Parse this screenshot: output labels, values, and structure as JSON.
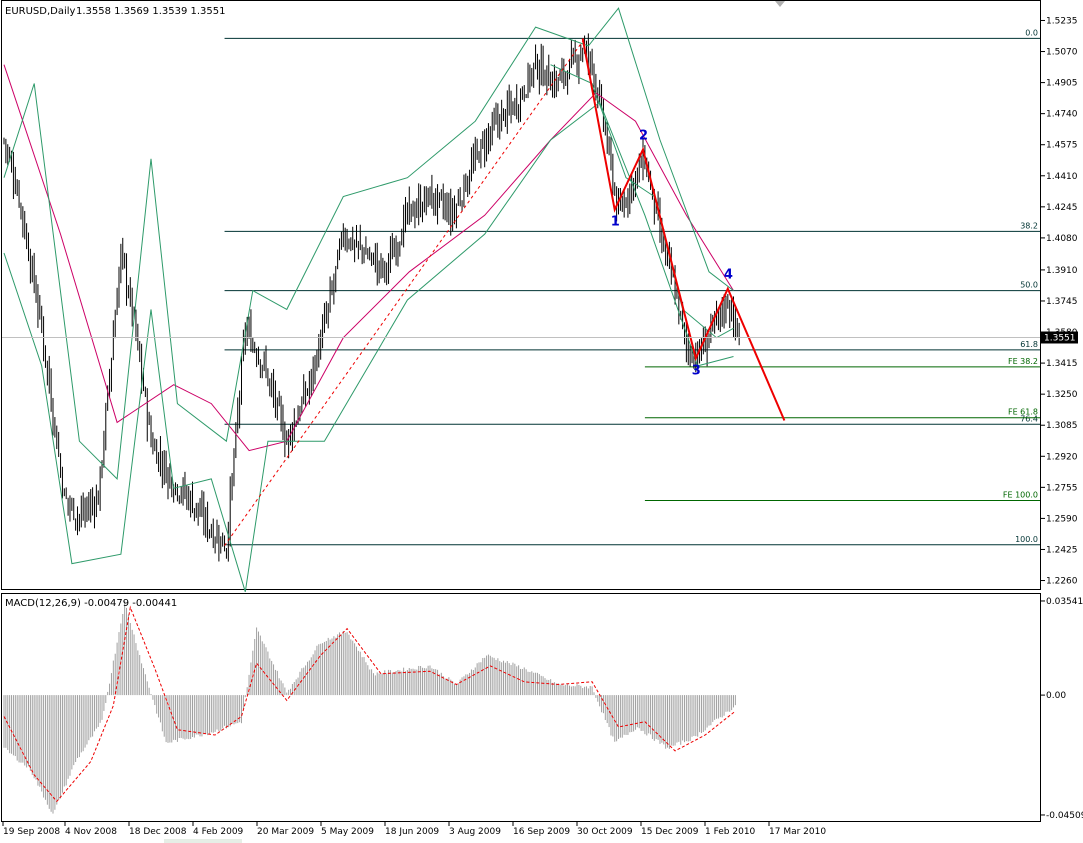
{
  "chart_data": [
    {
      "type": "candlestick",
      "title": "EURUSD,Daily",
      "ohlc_readout": "1.3558 1.3569 1.3539 1.3551",
      "current_price_label": "1.3551",
      "y_ticks": [
        "1.5235",
        "1.5070",
        "1.4905",
        "1.4740",
        "1.4575",
        "1.4410",
        "1.4245",
        "1.4080",
        "1.3910",
        "1.3745",
        "1.3580",
        "1.3415",
        "1.3250",
        "1.3085",
        "1.2920",
        "1.2755",
        "1.2590",
        "1.2425",
        "1.2260"
      ],
      "ylim": [
        1.2215,
        1.528
      ],
      "x_ticks": [
        "19 Sep 2008",
        "4 Nov 2008",
        "18 Dec 2008",
        "4 Feb 2009",
        "20 Mar 2009",
        "5 May 2009",
        "18 Jun 2009",
        "3 Aug 2009",
        "16 Sep 2009",
        "30 Oct 2009",
        "15 Dec 2009",
        "1 Feb 2010",
        "17 Mar 2010"
      ],
      "price_path": [
        {
          "bar": 0,
          "price": 1.46
        },
        {
          "bar": 8,
          "price": 1.43
        },
        {
          "bar": 20,
          "price": 1.36
        },
        {
          "bar": 32,
          "price": 1.27
        },
        {
          "bar": 40,
          "price": 1.26
        },
        {
          "bar": 50,
          "price": 1.27
        },
        {
          "bar": 62,
          "price": 1.4
        },
        {
          "bar": 68,
          "price": 1.37
        },
        {
          "bar": 78,
          "price": 1.3
        },
        {
          "bar": 88,
          "price": 1.28
        },
        {
          "bar": 98,
          "price": 1.27
        },
        {
          "bar": 112,
          "price": 1.25
        },
        {
          "bar": 118,
          "price": 1.245
        },
        {
          "bar": 128,
          "price": 1.36
        },
        {
          "bar": 138,
          "price": 1.34
        },
        {
          "bar": 150,
          "price": 1.3
        },
        {
          "bar": 162,
          "price": 1.33
        },
        {
          "bar": 172,
          "price": 1.37
        },
        {
          "bar": 180,
          "price": 1.41
        },
        {
          "bar": 192,
          "price": 1.4
        },
        {
          "bar": 202,
          "price": 1.39
        },
        {
          "bar": 214,
          "price": 1.42
        },
        {
          "bar": 226,
          "price": 1.43
        },
        {
          "bar": 238,
          "price": 1.42
        },
        {
          "bar": 250,
          "price": 1.45
        },
        {
          "bar": 262,
          "price": 1.47
        },
        {
          "bar": 272,
          "price": 1.48
        },
        {
          "bar": 282,
          "price": 1.5
        },
        {
          "bar": 292,
          "price": 1.49
        },
        {
          "bar": 302,
          "price": 1.5
        },
        {
          "bar": 307,
          "price": 1.51
        },
        {
          "bar": 312,
          "price": 1.5
        },
        {
          "bar": 318,
          "price": 1.47
        },
        {
          "bar": 326,
          "price": 1.42
        },
        {
          "bar": 332,
          "price": 1.435
        },
        {
          "bar": 340,
          "price": 1.45
        },
        {
          "bar": 348,
          "price": 1.41
        },
        {
          "bar": 356,
          "price": 1.38
        },
        {
          "bar": 362,
          "price": 1.35
        },
        {
          "bar": 368,
          "price": 1.345
        },
        {
          "bar": 376,
          "price": 1.36
        },
        {
          "bar": 384,
          "price": 1.375
        },
        {
          "bar": 390,
          "price": 1.355
        }
      ],
      "overlays": [
        {
          "name": "MA",
          "color": "#cc0066",
          "points": [
            {
              "bar": 0,
              "price": 1.5
            },
            {
              "bar": 30,
              "price": 1.41
            },
            {
              "bar": 60,
              "price": 1.31
            },
            {
              "bar": 90,
              "price": 1.33
            },
            {
              "bar": 110,
              "price": 1.32
            },
            {
              "bar": 130,
              "price": 1.295
            },
            {
              "bar": 150,
              "price": 1.3
            },
            {
              "bar": 180,
              "price": 1.355
            },
            {
              "bar": 215,
              "price": 1.39
            },
            {
              "bar": 255,
              "price": 1.42
            },
            {
              "bar": 290,
              "price": 1.46
            },
            {
              "bar": 314,
              "price": 1.485
            },
            {
              "bar": 335,
              "price": 1.47
            },
            {
              "bar": 362,
              "price": 1.42
            },
            {
              "bar": 387,
              "price": 1.38
            }
          ]
        },
        {
          "name": "Bollinger upper",
          "color": "#2e9a6a",
          "points": [
            {
              "bar": 0,
              "price": 1.44
            },
            {
              "bar": 16,
              "price": 1.49
            },
            {
              "bar": 40,
              "price": 1.3
            },
            {
              "bar": 60,
              "price": 1.28
            },
            {
              "bar": 78,
              "price": 1.45
            },
            {
              "bar": 92,
              "price": 1.32
            },
            {
              "bar": 118,
              "price": 1.3
            },
            {
              "bar": 132,
              "price": 1.38
            },
            {
              "bar": 150,
              "price": 1.37
            },
            {
              "bar": 180,
              "price": 1.43
            },
            {
              "bar": 214,
              "price": 1.44
            },
            {
              "bar": 250,
              "price": 1.47
            },
            {
              "bar": 282,
              "price": 1.52
            },
            {
              "bar": 310,
              "price": 1.51
            },
            {
              "bar": 326,
              "price": 1.53
            },
            {
              "bar": 348,
              "price": 1.46
            },
            {
              "bar": 374,
              "price": 1.39
            },
            {
              "bar": 387,
              "price": 1.38
            }
          ]
        },
        {
          "name": "Bollinger lower",
          "color": "#2e9a6a",
          "points": [
            {
              "bar": 0,
              "price": 1.4
            },
            {
              "bar": 20,
              "price": 1.34
            },
            {
              "bar": 36,
              "price": 1.235
            },
            {
              "bar": 62,
              "price": 1.24
            },
            {
              "bar": 78,
              "price": 1.37
            },
            {
              "bar": 90,
              "price": 1.275
            },
            {
              "bar": 110,
              "price": 1.28
            },
            {
              "bar": 128,
              "price": 1.22
            },
            {
              "bar": 140,
              "price": 1.3
            },
            {
              "bar": 170,
              "price": 1.3
            },
            {
              "bar": 214,
              "price": 1.375
            },
            {
              "bar": 255,
              "price": 1.41
            },
            {
              "bar": 290,
              "price": 1.46
            },
            {
              "bar": 316,
              "price": 1.48
            },
            {
              "bar": 340,
              "price": 1.42
            },
            {
              "bar": 368,
              "price": 1.34
            },
            {
              "bar": 387,
              "price": 1.345
            }
          ]
        },
        {
          "name": "Bollinger mid",
          "color": "#2e9a6a",
          "points": [
            {
              "bar": 290,
              "price": 1.5
            },
            {
              "bar": 312,
              "price": 1.49
            },
            {
              "bar": 330,
              "price": 1.44
            },
            {
              "bar": 345,
              "price": 1.43
            },
            {
              "bar": 360,
              "price": 1.37
            },
            {
              "bar": 378,
              "price": 1.355
            },
            {
              "bar": 387,
              "price": 1.36
            }
          ]
        }
      ],
      "trend_line": {
        "color": "#ee0000",
        "points": [
          {
            "bar": 117,
            "price": 1.2445
          },
          {
            "bar": 307,
            "price": 1.5125
          }
        ]
      },
      "fibo_retracement": {
        "color": "#003333",
        "start_bar": 117,
        "levels": [
          {
            "label": "0.0",
            "price": 1.514
          },
          {
            "label": "38.2",
            "price": 1.4115
          },
          {
            "label": "50.0",
            "price": 1.38
          },
          {
            "label": "61.8",
            "price": 1.3485
          },
          {
            "label": "76.4",
            "price": 1.309
          },
          {
            "label": "100.0",
            "price": 1.245
          }
        ]
      },
      "fibo_expansion": {
        "color": "#006600",
        "start_bar": 340,
        "levels": [
          {
            "label": "FE 38.2",
            "price": 1.3395
          },
          {
            "label": "FE 61.8",
            "price": 1.3125
          },
          {
            "label": "FE 100.0",
            "price": 1.2685
          }
        ]
      },
      "elliott_waves": {
        "color": "#0000cc",
        "line_color": "#ee0000",
        "points": [
          {
            "label": "",
            "bar": 307,
            "price": 1.514
          },
          {
            "label": "1",
            "bar": 324,
            "price": 1.423
          },
          {
            "label": "2",
            "bar": 339,
            "price": 1.455
          },
          {
            "label": "3",
            "bar": 367,
            "price": 1.344
          },
          {
            "label": "4",
            "bar": 384,
            "price": 1.381
          },
          {
            "label": "",
            "bar": 414,
            "price": 1.311
          }
        ]
      }
    },
    {
      "type": "bar",
      "title": "MACD(12,26,9) -0.00479 -0.00441",
      "y_ticks": [
        "0.03541",
        "0.00",
        "-0.04509"
      ],
      "ylim": [
        -0.0451,
        0.0354
      ],
      "histogram_color": "#a0a0a0",
      "signal_color": "#ee0000",
      "histogram_path": [
        {
          "bar": 0,
          "price": -0.02
        },
        {
          "bar": 14,
          "price": -0.028
        },
        {
          "bar": 26,
          "price": -0.045
        },
        {
          "bar": 38,
          "price": -0.025
        },
        {
          "bar": 52,
          "price": -0.01
        },
        {
          "bar": 64,
          "price": 0.035
        },
        {
          "bar": 74,
          "price": 0.01
        },
        {
          "bar": 86,
          "price": -0.018
        },
        {
          "bar": 110,
          "price": -0.014
        },
        {
          "bar": 126,
          "price": -0.01
        },
        {
          "bar": 134,
          "price": 0.025
        },
        {
          "bar": 150,
          "price": 0.001
        },
        {
          "bar": 168,
          "price": 0.02
        },
        {
          "bar": 182,
          "price": 0.024
        },
        {
          "bar": 196,
          "price": 0.008
        },
        {
          "bar": 226,
          "price": 0.011
        },
        {
          "bar": 240,
          "price": 0.004
        },
        {
          "bar": 256,
          "price": 0.015
        },
        {
          "bar": 276,
          "price": 0.01
        },
        {
          "bar": 294,
          "price": 0.004
        },
        {
          "bar": 312,
          "price": 0.003
        },
        {
          "bar": 324,
          "price": -0.018
        },
        {
          "bar": 336,
          "price": -0.012
        },
        {
          "bar": 352,
          "price": -0.02
        },
        {
          "bar": 366,
          "price": -0.016
        },
        {
          "bar": 388,
          "price": -0.004
        }
      ],
      "signal_path": [
        {
          "bar": 0,
          "price": -0.008
        },
        {
          "bar": 16,
          "price": -0.03
        },
        {
          "bar": 28,
          "price": -0.04
        },
        {
          "bar": 46,
          "price": -0.025
        },
        {
          "bar": 58,
          "price": -0.004
        },
        {
          "bar": 67,
          "price": 0.033
        },
        {
          "bar": 80,
          "price": 0.01
        },
        {
          "bar": 92,
          "price": -0.013
        },
        {
          "bar": 112,
          "price": -0.015
        },
        {
          "bar": 126,
          "price": -0.008
        },
        {
          "bar": 134,
          "price": 0.012
        },
        {
          "bar": 150,
          "price": -0.002
        },
        {
          "bar": 168,
          "price": 0.015
        },
        {
          "bar": 182,
          "price": 0.025
        },
        {
          "bar": 200,
          "price": 0.008
        },
        {
          "bar": 226,
          "price": 0.009
        },
        {
          "bar": 240,
          "price": 0.004
        },
        {
          "bar": 258,
          "price": 0.011
        },
        {
          "bar": 276,
          "price": 0.005
        },
        {
          "bar": 294,
          "price": 0.004
        },
        {
          "bar": 312,
          "price": 0.005
        },
        {
          "bar": 326,
          "price": -0.012
        },
        {
          "bar": 340,
          "price": -0.01
        },
        {
          "bar": 356,
          "price": -0.021
        },
        {
          "bar": 372,
          "price": -0.015
        },
        {
          "bar": 388,
          "price": -0.006
        }
      ]
    }
  ]
}
